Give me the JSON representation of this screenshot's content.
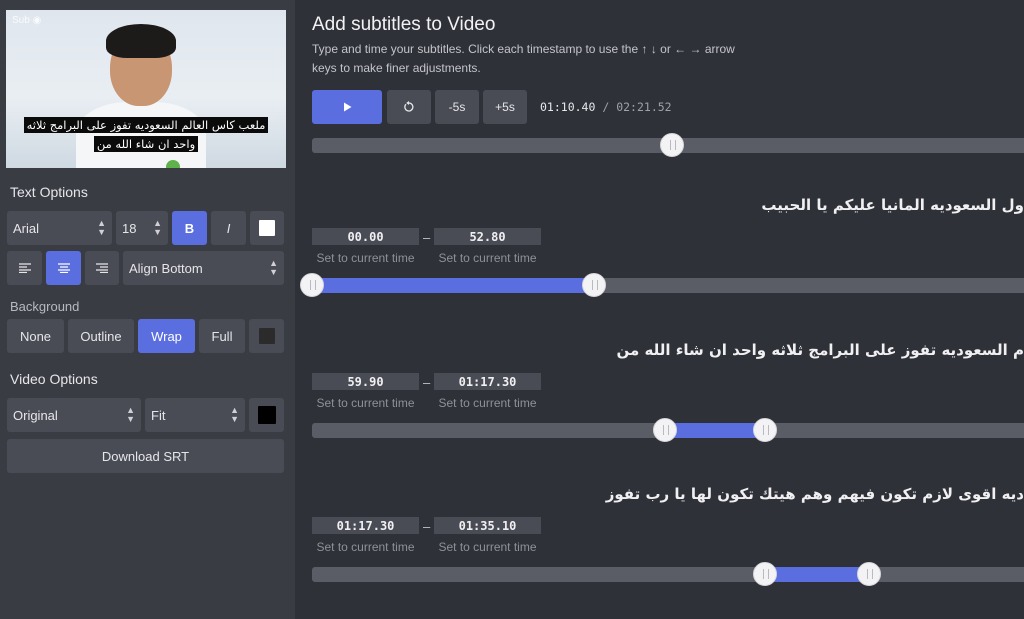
{
  "video": {
    "badge": "Sub ◉",
    "caption_line1": "ملعب كاس العالم السعوديه تفوز على البرامج ثلاثه",
    "caption_line2": "واحد ان شاء الله من"
  },
  "text_options": {
    "title": "Text Options",
    "font": "Arial",
    "size": "18",
    "bold_label": "B",
    "italic_label": "I",
    "color": "#ffffff",
    "align_left_icon": "align-left-icon",
    "align_center_icon": "align-center-icon",
    "align_right_icon": "align-right-icon",
    "position": "Align Bottom"
  },
  "background": {
    "title": "Background",
    "options": [
      "None",
      "Outline",
      "Wrap",
      "Full"
    ],
    "selected": "Wrap",
    "color": "#2b2b2b"
  },
  "video_options": {
    "title": "Video Options",
    "size": "Original",
    "fit": "Fit",
    "color": "#000000",
    "download_label": "Download SRT"
  },
  "main": {
    "title": "Add subtitles to Video",
    "description": "Type and time your subtitles. Click each timestamp to use the ↑ ↓ or ← → arrow keys to make finer adjustments."
  },
  "player": {
    "play_icon": "play-icon",
    "restart_icon": "restart-icon",
    "back_label": "-5s",
    "forward_label": "+5s",
    "current_time": "01:10.40",
    "separator": "/",
    "duration": "02:21.52",
    "progress_fraction": 0.5
  },
  "subtitles": [
    {
      "text": "ول السعوديه المانيا عليكم يا الحبيب",
      "start": "00.00",
      "end": "52.80",
      "set_start_label": "Set to current time",
      "set_end_label": "Set to current time",
      "range_start": 0.0,
      "range_end": 0.392
    },
    {
      "text": "م السعوديه تفوز على البرامج ثلاثه واحد ان شاء الله من",
      "start": "59.90",
      "end": "01:17.30",
      "set_start_label": "Set to current time",
      "set_end_label": "Set to current time",
      "range_start": 0.49,
      "range_end": 0.629
    },
    {
      "text": "ديه اقوى لازم تكون فيهم وهم هيتك تكون لها يا رب تفوز",
      "start": "01:17.30",
      "end": "01:35.10",
      "set_start_label": "Set to current time",
      "set_end_label": "Set to current time",
      "range_start": 0.629,
      "range_end": 0.774
    }
  ],
  "range_dash": "–"
}
